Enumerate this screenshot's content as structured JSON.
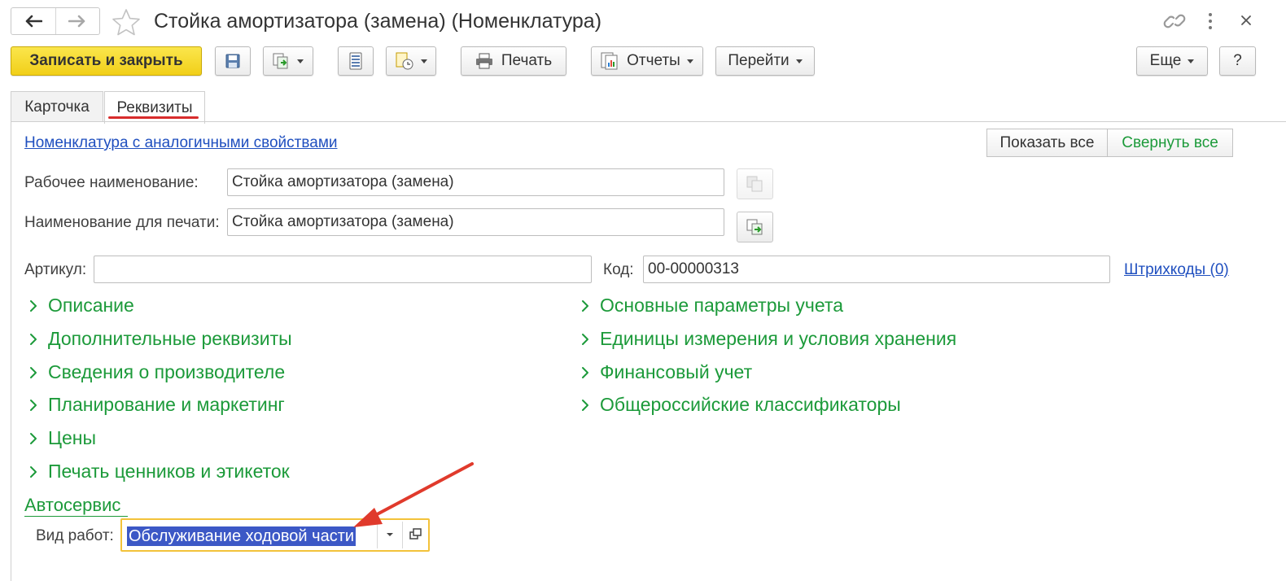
{
  "window": {
    "title": "Стойка амортизатора (замена) (Номенклатура)",
    "icons": [
      "back-arrow-icon",
      "forward-arrow-icon",
      "star-icon",
      "link-icon",
      "more-vertical-icon",
      "close-icon"
    ]
  },
  "toolbar": {
    "save_close": "Записать и закрыть",
    "print": "Печать",
    "reports": "Отчеты",
    "goto": "Перейти",
    "more": "Еще",
    "help": "?"
  },
  "tabs": [
    {
      "label": "Карточка",
      "active": false
    },
    {
      "label": "Реквизиты",
      "active": true
    }
  ],
  "form": {
    "similar_link": "Номенклатура с аналогичными свойствами",
    "show_all": "Показать все",
    "collapse_all": "Свернуть все",
    "work_name_label": "Рабочее наименование:",
    "work_name_value": "Стойка амортизатора (замена)",
    "print_name_label": "Наименование для печати:",
    "print_name_value": "Стойка амортизатора (замена)",
    "article_label": "Артикул:",
    "article_value": "",
    "code_label": "Код:",
    "code_value": "00-00000313",
    "barcodes_link": "Штрихкоды (0)"
  },
  "groups_left": [
    "Описание",
    "Дополнительные реквизиты",
    "Сведения о производителе",
    "Планирование и маркетинг",
    "Цены",
    "Печать ценников и этикеток"
  ],
  "groups_right": [
    "Основные параметры учета",
    "Единицы измерения и условия хранения",
    "Финансовый учет",
    "Общероссийские классификаторы"
  ],
  "autoservice": {
    "title": "Автосервис",
    "work_type_label": "Вид работ:",
    "work_type_value": "Обслуживание ходовой части"
  },
  "colors": {
    "accent_yellow": "#f5d52a",
    "group_green": "#1c9a3a",
    "link_blue": "#1f4fbf",
    "tab_underline_red": "#d82c2c",
    "selection_blue": "#3c58c6",
    "focus_border": "#f3c23a",
    "annotation_arrow": "#e03a2c"
  }
}
